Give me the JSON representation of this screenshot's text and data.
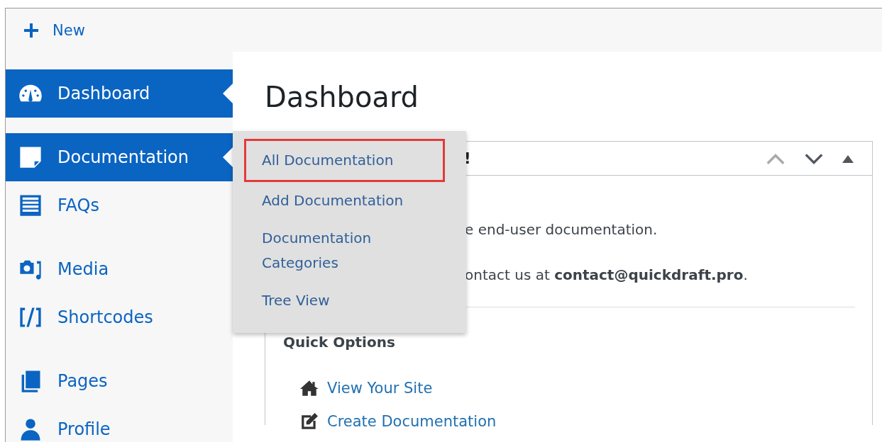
{
  "toolbar": {
    "new_label": "New"
  },
  "sidebar": {
    "groups": [
      [
        {
          "label": "Dashboard",
          "kind": "gauge",
          "highlighted": true
        }
      ],
      [
        {
          "label": "Documentation",
          "kind": "document",
          "highlighted": true
        },
        {
          "label": "FAQs",
          "kind": "list",
          "highlighted": false
        }
      ],
      [
        {
          "label": "Media",
          "kind": "media",
          "highlighted": false
        },
        {
          "label": "Shortcodes",
          "kind": "code",
          "highlighted": false
        }
      ],
      [
        {
          "label": "Pages",
          "kind": "pages",
          "highlighted": false
        },
        {
          "label": "Profile",
          "kind": "person",
          "highlighted": false
        }
      ]
    ]
  },
  "flyout": {
    "items": [
      {
        "label": "All Documentation",
        "highlighted": true
      },
      {
        "label": "Add Documentation",
        "highlighted": false
      },
      {
        "label": "Documentation Categories",
        "highlighted": false
      },
      {
        "label": "Tree View",
        "highlighted": false
      }
    ]
  },
  "page_title": "Dashboard",
  "panel": {
    "title": "!",
    "controls": [
      {
        "kind": "up",
        "disabled": true
      },
      {
        "kind": "down",
        "disabled": false
      },
      {
        "kind": "toggle",
        "disabled": false
      }
    ],
    "lines": [
      "e end-user documentation.",
      "ontact us at **contact@quickdraft.pro**."
    ],
    "quick_options": {
      "heading": "Quick Options",
      "links": [
        {
          "label": "View Your Site",
          "kind": "home"
        },
        {
          "label": "Create Documentation",
          "kind": "edit"
        }
      ]
    }
  }
}
